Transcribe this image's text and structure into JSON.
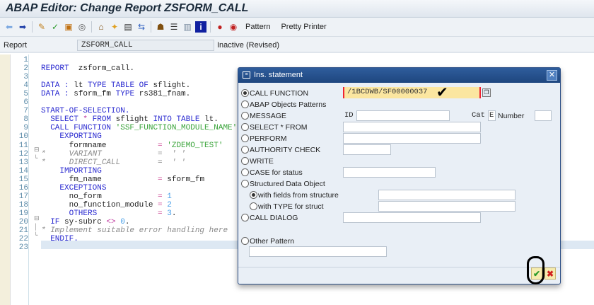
{
  "title": "ABAP Editor: Change Report ZSFORM_CALL",
  "toolbar": {
    "icons": [
      "back-icon",
      "forward-icon",
      "toggle-edit-icon",
      "check-icon",
      "activate-icon",
      "test-icon",
      "where-used-icon",
      "breakpoint-icon",
      "display-object-list-icon",
      "navigate-icon",
      "hierarchy-icon",
      "stack-icon",
      "layout-icon",
      "info-icon",
      "bookmark-icon",
      "user-icon"
    ],
    "pattern": "Pattern",
    "pretty_printer": "Pretty Printer"
  },
  "report": {
    "label": "Report",
    "value": "ZSFORM_CALL",
    "status": "Inactive (Revised)"
  },
  "code": [
    [],
    [
      [
        "REPORT",
        "kw"
      ],
      [
        "  zsform_call.",
        "id"
      ]
    ],
    [],
    [
      [
        "DATA",
        "kw"
      ],
      [
        " : ",
        "kw"
      ],
      [
        "lt ",
        "id"
      ],
      [
        "TYPE TABLE OF",
        "kw"
      ],
      [
        " sflight.",
        "id"
      ]
    ],
    [
      [
        "DATA",
        "kw"
      ],
      [
        " : ",
        "kw"
      ],
      [
        "sform_fm ",
        "id"
      ],
      [
        "TYPE",
        "kw"
      ],
      [
        " rs381_fnam.",
        "id"
      ]
    ],
    [],
    [
      [
        "START-OF-SELECTION.",
        "kw"
      ]
    ],
    [
      [
        "  SELECT",
        "kw"
      ],
      [
        " * ",
        "op"
      ],
      [
        "FROM",
        "kw"
      ],
      [
        " sflight ",
        "id"
      ],
      [
        "INTO TABLE",
        "kw"
      ],
      [
        " lt.",
        "id"
      ]
    ],
    [
      [
        "  CALL FUNCTION",
        "kw"
      ],
      [
        " 'SSF_FUNCTION_MODULE_NAME'",
        "str"
      ]
    ],
    [
      [
        "    EXPORTING",
        "kw"
      ]
    ],
    [
      [
        "      formname           ",
        "id"
      ],
      [
        "=",
        "eq"
      ],
      [
        " 'ZDEMO_TEST'",
        "str"
      ]
    ],
    [
      [
        "*     VARIANT            =  ' '",
        "com"
      ]
    ],
    [
      [
        "*     DIRECT_CALL        =  ' '",
        "com"
      ]
    ],
    [
      [
        "    IMPORTING",
        "kw"
      ]
    ],
    [
      [
        "      fm_name            ",
        "id"
      ],
      [
        "=",
        "eq"
      ],
      [
        " sform_fm",
        "id"
      ]
    ],
    [
      [
        "    EXCEPTIONS",
        "kw"
      ]
    ],
    [
      [
        "      no_form            ",
        "id"
      ],
      [
        "=",
        "eq"
      ],
      [
        " 1",
        "num"
      ]
    ],
    [
      [
        "      no_function_module ",
        "id"
      ],
      [
        "=",
        "eq"
      ],
      [
        " 2",
        "num"
      ]
    ],
    [
      [
        "      OTHERS             ",
        "kw"
      ],
      [
        "=",
        "eq"
      ],
      [
        " 3",
        "num"
      ],
      [
        ".",
        "id"
      ]
    ],
    [
      [
        "  IF",
        "kw"
      ],
      [
        " sy-subrc ",
        "id"
      ],
      [
        "<>",
        "op"
      ],
      [
        " 0",
        "num"
      ],
      [
        ".",
        "id"
      ]
    ],
    [
      [
        "* Implement suitable error handling here",
        "com"
      ]
    ],
    [
      [
        "  ENDIF.",
        "kw"
      ]
    ],
    []
  ],
  "dialog": {
    "title": "Ins. statement",
    "options": [
      {
        "label": "CALL FUNCTION",
        "selected": true,
        "value": "/1BCDWB/SF00000037"
      },
      {
        "label": "ABAP Objects Patterns",
        "selected": false
      },
      {
        "label": "MESSAGE",
        "selected": false,
        "id_label": "ID",
        "id_value": "",
        "cat_label": "Cat",
        "cat_value": "E",
        "number_label": "Number",
        "number_value": ""
      },
      {
        "label": "SELECT * FROM",
        "selected": false,
        "value": ""
      },
      {
        "label": "PERFORM",
        "selected": false,
        "value": ""
      },
      {
        "label": "AUTHORITY CHECK",
        "selected": false,
        "value": ""
      },
      {
        "label": "WRITE",
        "selected": false
      },
      {
        "label": "CASE for status",
        "selected": false,
        "value": ""
      },
      {
        "label": "Structured Data Object",
        "selected": false
      },
      {
        "label": "with fields from structure",
        "selected": true,
        "value": ""
      },
      {
        "label": "with TYPE for struct",
        "selected": false,
        "value": ""
      },
      {
        "label": "CALL DIALOG",
        "selected": false,
        "value": ""
      },
      {
        "label": "Other Pattern",
        "selected": false,
        "value": ""
      }
    ],
    "ok_icon": "continue-check-icon",
    "cancel_icon": "cancel-x-icon"
  }
}
